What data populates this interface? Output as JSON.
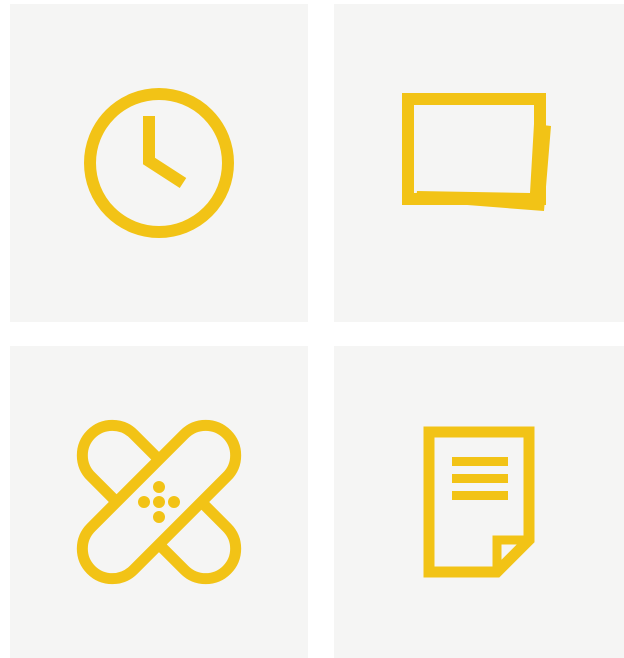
{
  "colors": {
    "background": "#ffffff",
    "tile": "#f5f5f4",
    "icon": "#f2c316"
  },
  "tiles": [
    {
      "icon": "clock-icon"
    },
    {
      "icon": "photos-icon"
    },
    {
      "icon": "bandage-icon"
    },
    {
      "icon": "document-icon"
    }
  ]
}
